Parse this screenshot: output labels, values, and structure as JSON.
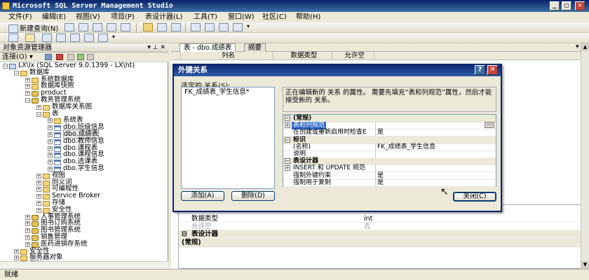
{
  "window": {
    "title": "Microsoft SQL Server Management Studio"
  },
  "menu": [
    "文件(F)",
    "编辑(E)",
    "视图(V)",
    "项目(P)",
    "表设计器(L)",
    "工具(T)",
    "窗口(W)",
    "社区(C)",
    "帮助(H)"
  ],
  "toolbar": {
    "new_query": "新建查询(N)"
  },
  "object_explorer": {
    "title": "对象资源管理器",
    "connect": "连接(O) ▾",
    "tree": [
      {
        "label": "LX\\lx (SQL Server 9.0.1399 - LX\\ht)",
        "level": 0,
        "icon": "server",
        "exp": "−"
      },
      {
        "label": "数据库",
        "level": 1,
        "icon": "folder",
        "exp": "−"
      },
      {
        "label": "系统数据库",
        "level": 2,
        "icon": "folder",
        "exp": "+"
      },
      {
        "label": "数据库快照",
        "level": 2,
        "icon": "folder",
        "exp": "+"
      },
      {
        "label": "product",
        "level": 2,
        "icon": "db",
        "exp": "+"
      },
      {
        "label": "教务管理系统",
        "level": 2,
        "icon": "db",
        "exp": "−"
      },
      {
        "label": "数据库关系图",
        "level": 3,
        "icon": "folder",
        "exp": "+"
      },
      {
        "label": "表",
        "level": 3,
        "icon": "folder",
        "exp": "−"
      },
      {
        "label": "系统表",
        "level": 4,
        "icon": "folder",
        "exp": "+"
      },
      {
        "label": "dbo.班级信息",
        "level": 4,
        "icon": "table",
        "exp": "+"
      },
      {
        "label": "dbo.成绩表",
        "level": 4,
        "icon": "table",
        "exp": "+",
        "selected": true
      },
      {
        "label": "dbo.教师信息",
        "level": 4,
        "icon": "table",
        "exp": "+"
      },
      {
        "label": "dbo.课程表",
        "level": 4,
        "icon": "table",
        "exp": "+"
      },
      {
        "label": "dbo.课程信息",
        "level": 4,
        "icon": "table",
        "exp": "+"
      },
      {
        "label": "dbo.选课表",
        "level": 4,
        "icon": "table",
        "exp": "+"
      },
      {
        "label": "dbo.学生信息",
        "level": 4,
        "icon": "table",
        "exp": "+"
      },
      {
        "label": "视图",
        "level": 3,
        "icon": "folder",
        "exp": "+"
      },
      {
        "label": "同义词",
        "level": 3,
        "icon": "folder",
        "exp": "+"
      },
      {
        "label": "可编程性",
        "level": 3,
        "icon": "folder",
        "exp": "+"
      },
      {
        "label": "Service Broker",
        "level": 3,
        "icon": "folder",
        "exp": "+"
      },
      {
        "label": "存储",
        "level": 3,
        "icon": "folder",
        "exp": "+"
      },
      {
        "label": "安全性",
        "level": 3,
        "icon": "folder",
        "exp": "+"
      },
      {
        "label": "人事管理系统",
        "level": 2,
        "icon": "db",
        "exp": "+"
      },
      {
        "label": "图书订购系统",
        "level": 2,
        "icon": "db",
        "exp": "+"
      },
      {
        "label": "图书管理系统",
        "level": 2,
        "icon": "db",
        "exp": "+"
      },
      {
        "label": "销售管理",
        "level": 2,
        "icon": "db",
        "exp": "+"
      },
      {
        "label": "医药进销存系统",
        "level": 2,
        "icon": "db",
        "exp": "+"
      },
      {
        "label": "安全性",
        "level": 1,
        "icon": "folder",
        "exp": "+"
      },
      {
        "label": "服务器对象",
        "level": 1,
        "icon": "folder",
        "exp": "+"
      },
      {
        "label": "复制",
        "level": 1,
        "icon": "folder",
        "exp": "+"
      }
    ]
  },
  "editor": {
    "tabs": [
      "表 - dbo.成绩表",
      "摘要"
    ],
    "columns": [
      "列名",
      "数据类型",
      "允许空"
    ],
    "props": [
      {
        "k": "数据类型",
        "v": "int"
      },
      {
        "k": "允许空",
        "v": "否"
      },
      {
        "k": "表设计器",
        "cat": true
      },
      {
        "k": "(常规)",
        "cat": true
      }
    ]
  },
  "dialog": {
    "title": "外键关系",
    "help": "?",
    "close_x": "✕",
    "selected_label": "选定的 关系(S):",
    "relation_item": "FK_成绩表_学生信息*",
    "description": "正在编辑新的 关系 的属性。 需要先填充“表和列规范”属性，然后才能接受新的 关系。",
    "add_button": "添加(A)",
    "delete_button": "删除(D)",
    "close_button": "关闭(C)",
    "grid": [
      {
        "k": "(常规)",
        "cat": true,
        "ex": "−"
      },
      {
        "k": "表和列规范",
        "ex": "+",
        "highlight": true,
        "more": true
      },
      {
        "k": "在创建或重新启用时检查E",
        "v": "是"
      },
      {
        "k": "标识",
        "cat": true,
        "ex": "−"
      },
      {
        "k": "(名称)",
        "v": "FK_成绩表_学生信息"
      },
      {
        "k": "说明",
        "v": ""
      },
      {
        "k": "表设计器",
        "cat": true,
        "ex": "−"
      },
      {
        "k": "INSERT 和 UPDATE 规范",
        "ex": "+"
      },
      {
        "k": "强制外键约束",
        "v": "是"
      },
      {
        "k": "强制用于复制",
        "v": "是"
      }
    ]
  },
  "status": {
    "text": "就绪"
  }
}
